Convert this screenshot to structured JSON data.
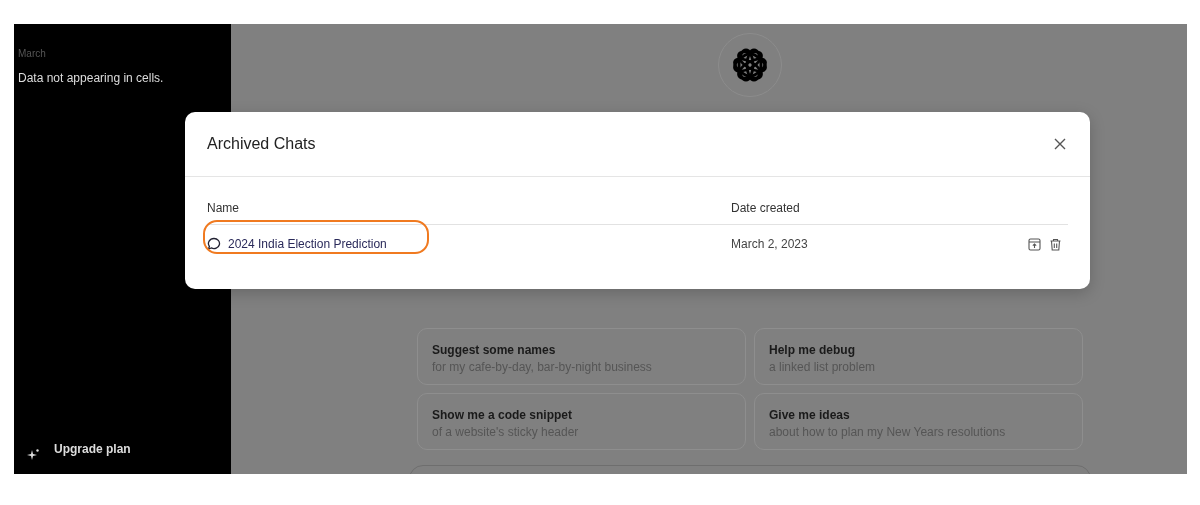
{
  "sidebar": {
    "section_label": "March",
    "items": [
      {
        "label": "Data not appearing in cells."
      }
    ],
    "upgrade": {
      "label": "Upgrade plan"
    }
  },
  "suggestions": [
    {
      "title": "Suggest some names",
      "subtitle": "for my cafe-by-day, bar-by-night business"
    },
    {
      "title": "Help me debug",
      "subtitle": "a linked list problem"
    },
    {
      "title": "Show me a code snippet",
      "subtitle": "of a website's sticky header"
    },
    {
      "title": "Give me ideas",
      "subtitle": "about how to plan my New Years resolutions"
    }
  ],
  "dialog": {
    "title": "Archived Chats",
    "table": {
      "columns": [
        "Name",
        "Date created"
      ],
      "rows": [
        {
          "name": "2024 India Election Prediction",
          "date": "March 2, 2023",
          "highlighted": true
        }
      ]
    }
  }
}
